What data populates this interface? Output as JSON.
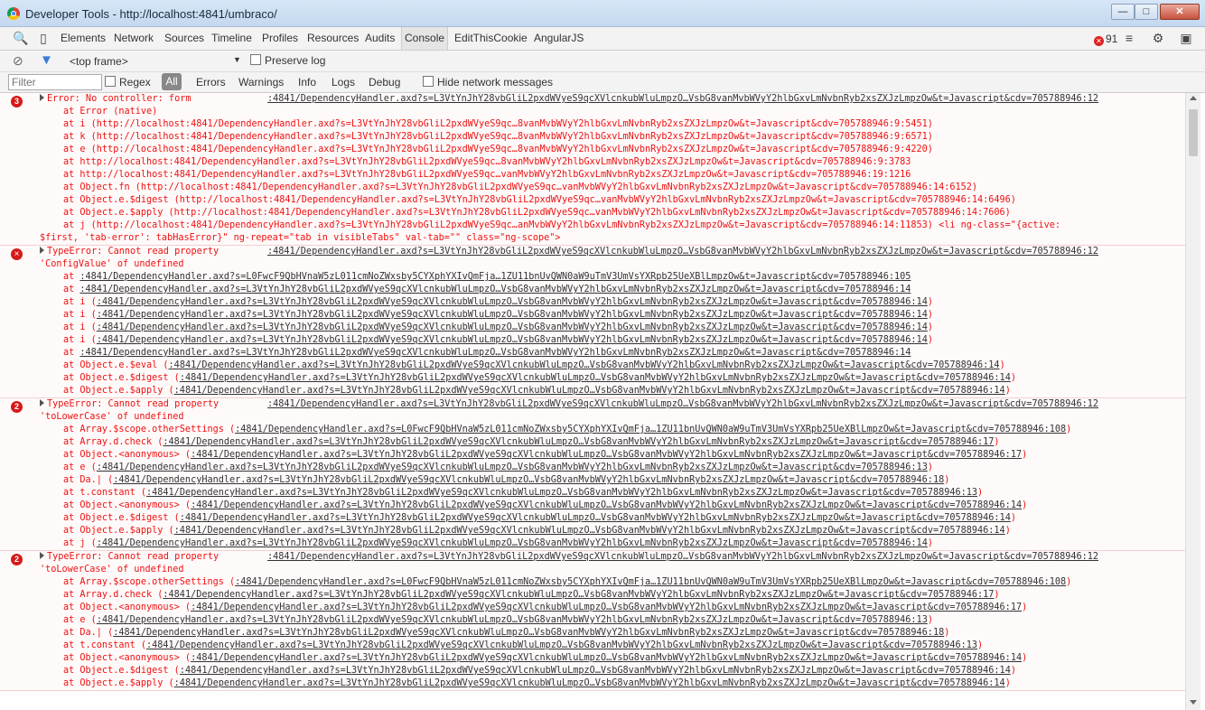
{
  "window": {
    "title": "Developer Tools - http://localhost:4841/umbraco/"
  },
  "tabs": [
    {
      "label": "Elements"
    },
    {
      "label": "Network"
    },
    {
      "label": "Sources"
    },
    {
      "label": "Timeline"
    },
    {
      "label": "Profiles"
    },
    {
      "label": "Resources"
    },
    {
      "label": "Audits"
    },
    {
      "label": "Console"
    },
    {
      "label": "EditThisCookie"
    },
    {
      "label": "AngularJS"
    }
  ],
  "error_count": "91",
  "console_toolbar": {
    "frame": "<top frame>",
    "preserve_log": "Preserve log"
  },
  "filter_bar": {
    "placeholder": "Filter",
    "regex": "Regex",
    "all": "All",
    "levels": [
      "Errors",
      "Warnings",
      "Info",
      "Logs",
      "Debug"
    ],
    "hide_network": "Hide network messages"
  },
  "messages": [
    {
      "badge": "3",
      "head": "Error: No controller: form",
      "source": ":4841/DependencyHandler.axd?s=L3VtYnJhY28vbGliL2pxdWVyeS9qcXVlcnkubWluLmpzO…VsbG8vanMvbWVyY2hlbGxvLmNvbnRyb2xsZXJzLmpzOw&t=Javascript&cdv=705788946:12",
      "lines": [
        {
          "indent": "l1",
          "text": "at Error (native)"
        },
        {
          "indent": "l1",
          "text": "at i (http://localhost:4841/DependencyHandler.axd?s=L3VtYnJhY28vbGliL2pxdWVyeS9qc…8vanMvbWVyY2hlbGxvLmNvbnRyb2xsZXJzLmpzOw&t=Javascript&cdv=705788946:9:5451)"
        },
        {
          "indent": "l1",
          "text": "at k (http://localhost:4841/DependencyHandler.axd?s=L3VtYnJhY28vbGliL2pxdWVyeS9qc…8vanMvbWVyY2hlbGxvLmNvbnRyb2xsZXJzLmpzOw&t=Javascript&cdv=705788946:9:6571)"
        },
        {
          "indent": "l1",
          "text": "at e (http://localhost:4841/DependencyHandler.axd?s=L3VtYnJhY28vbGliL2pxdWVyeS9qc…8vanMvbWVyY2hlbGxvLmNvbnRyb2xsZXJzLmpzOw&t=Javascript&cdv=705788946:9:4220)"
        },
        {
          "indent": "l1",
          "text": "at http://localhost:4841/DependencyHandler.axd?s=L3VtYnJhY28vbGliL2pxdWVyeS9qc…8vanMvbWVyY2hlbGxvLmNvbnRyb2xsZXJzLmpzOw&t=Javascript&cdv=705788946:9:3783"
        },
        {
          "indent": "l1",
          "text": "at http://localhost:4841/DependencyHandler.axd?s=L3VtYnJhY28vbGliL2pxdWVyeS9qc…vanMvbWVyY2hlbGxvLmNvbnRyb2xsZXJzLmpzOw&t=Javascript&cdv=705788946:19:1216"
        },
        {
          "indent": "l1",
          "text": "at Object.fn (http://localhost:4841/DependencyHandler.axd?s=L3VtYnJhY28vbGliL2pxdWVyeS9qc…vanMvbWVyY2hlbGxvLmNvbnRyb2xsZXJzLmpzOw&t=Javascript&cdv=705788946:14:6152)"
        },
        {
          "indent": "l1",
          "text": "at Object.e.$digest (http://localhost:4841/DependencyHandler.axd?s=L3VtYnJhY28vbGliL2pxdWVyeS9qc…vanMvbWVyY2hlbGxvLmNvbnRyb2xsZXJzLmpzOw&t=Javascript&cdv=705788946:14:6496)"
        },
        {
          "indent": "l1",
          "text": "at Object.e.$apply (http://localhost:4841/DependencyHandler.axd?s=L3VtYnJhY28vbGliL2pxdWVyeS9qc…vanMvbWVyY2hlbGxvLmNvbnRyb2xsZXJzLmpzOw&t=Javascript&cdv=705788946:14:7606)"
        },
        {
          "indent": "l1",
          "text": "at j (http://localhost:4841/DependencyHandler.axd?s=L3VtYnJhY28vbGliL2pxdWVyeS9qc…anMvbWVyY2hlbGxvLmNvbnRyb2xsZXJzLmpzOw&t=Javascript&cdv=705788946:14:11853) <li ng-class=\"{active:"
        },
        {
          "indent": "l2",
          "text": "$first, 'tab-error': tabHasError}\" ng-repeat=\"tab in visibleTabs\" val-tab=\"\" class=\"ng-scope\">"
        }
      ]
    },
    {
      "badge": "×",
      "head": "TypeError: Cannot read property",
      "source": ":4841/DependencyHandler.axd?s=L3VtYnJhY28vbGliL2pxdWVyeS9qcXVlcnkubWluLmpzO…VsbG8vanMvbWVyY2hlbGxvLmNvbnRyb2xsZXJzLmpzOw&t=Javascript&cdv=705788946:12",
      "lines": [
        {
          "indent": "l2",
          "text": "'ConfigValue' of undefined"
        },
        {
          "indent": "l1",
          "pre": "at ",
          "src": ":4841/DependencyHandler.axd?s=L0FwcF9QbHVnaW5zL011cmNoZWxsby5CYXphYXIvQmFja…1ZU11bnUvQWN0aW9uTmV3UmVsYXRpb25UeXBlLmpzOw&t=Javascript&cdv=705788946:105"
        },
        {
          "indent": "l1",
          "pre": "at ",
          "src": ":4841/DependencyHandler.axd?s=L3VtYnJhY28vbGliL2pxdWVyeS9qcXVlcnkubWluLmpzO…VsbG8vanMvbWVyY2hlbGxvLmNvbnRyb2xsZXJzLmpzOw&t=Javascript&cdv=705788946:14"
        },
        {
          "indent": "l1",
          "pre": "at i (",
          "src": ":4841/DependencyHandler.axd?s=L3VtYnJhY28vbGliL2pxdWVyeS9qcXVlcnkubWluLmpzO…VsbG8vanMvbWVyY2hlbGxvLmNvbnRyb2xsZXJzLmpzOw&t=Javascript&cdv=705788946:14",
          "post": ")"
        },
        {
          "indent": "l1",
          "pre": "at i (",
          "src": ":4841/DependencyHandler.axd?s=L3VtYnJhY28vbGliL2pxdWVyeS9qcXVlcnkubWluLmpzO…VsbG8vanMvbWVyY2hlbGxvLmNvbnRyb2xsZXJzLmpzOw&t=Javascript&cdv=705788946:14",
          "post": ")"
        },
        {
          "indent": "l1",
          "pre": "at i (",
          "src": ":4841/DependencyHandler.axd?s=L3VtYnJhY28vbGliL2pxdWVyeS9qcXVlcnkubWluLmpzO…VsbG8vanMvbWVyY2hlbGxvLmNvbnRyb2xsZXJzLmpzOw&t=Javascript&cdv=705788946:14",
          "post": ")"
        },
        {
          "indent": "l1",
          "pre": "at i (",
          "src": ":4841/DependencyHandler.axd?s=L3VtYnJhY28vbGliL2pxdWVyeS9qcXVlcnkubWluLmpzO…VsbG8vanMvbWVyY2hlbGxvLmNvbnRyb2xsZXJzLmpzOw&t=Javascript&cdv=705788946:14",
          "post": ")"
        },
        {
          "indent": "l1",
          "pre": "at ",
          "src": ":4841/DependencyHandler.axd?s=L3VtYnJhY28vbGliL2pxdWVyeS9qcXVlcnkubWluLmpzO…VsbG8vanMvbWVyY2hlbGxvLmNvbnRyb2xsZXJzLmpzOw&t=Javascript&cdv=705788946:14"
        },
        {
          "indent": "l1",
          "pre": "at Object.e.$eval (",
          "src": ":4841/DependencyHandler.axd?s=L3VtYnJhY28vbGliL2pxdWVyeS9qcXVlcnkubWluLmpzO…VsbG8vanMvbWVyY2hlbGxvLmNvbnRyb2xsZXJzLmpzOw&t=Javascript&cdv=705788946:14",
          "post": ")"
        },
        {
          "indent": "l1",
          "pre": "at Object.e.$digest (",
          "src": ":4841/DependencyHandler.axd?s=L3VtYnJhY28vbGliL2pxdWVyeS9qcXVlcnkubWluLmpzO…VsbG8vanMvbWVyY2hlbGxvLmNvbnRyb2xsZXJzLmpzOw&t=Javascript&cdv=705788946:14",
          "post": ")"
        },
        {
          "indent": "l1",
          "pre": "at Object.e.$apply (",
          "src": ":4841/DependencyHandler.axd?s=L3VtYnJhY28vbGliL2pxdWVyeS9qcXVlcnkubWluLmpzO…VsbG8vanMvbWVyY2hlbGxvLmNvbnRyb2xsZXJzLmpzOw&t=Javascript&cdv=705788946:14",
          "post": ")"
        }
      ]
    },
    {
      "badge": "2",
      "head": "TypeError: Cannot read property",
      "source": ":4841/DependencyHandler.axd?s=L3VtYnJhY28vbGliL2pxdWVyeS9qcXVlcnkubWluLmpzO…VsbG8vanMvbWVyY2hlbGxvLmNvbnRyb2xsZXJzLmpzOw&t=Javascript&cdv=705788946:12",
      "lines": [
        {
          "indent": "l2",
          "text": "'toLowerCase' of undefined"
        },
        {
          "indent": "l1",
          "pre": "at Array.$scope.otherSettings (",
          "src": ":4841/DependencyHandler.axd?s=L0FwcF9QbHVnaW5zL011cmNoZWxsby5CYXphYXIvQmFja…1ZU11bnUvQWN0aW9uTmV3UmVsYXRpb25UeXBlLmpzOw&t=Javascript&cdv=705788946:108",
          "post": ")"
        },
        {
          "indent": "l1",
          "pre": "at Array.d.check (",
          "src": ":4841/DependencyHandler.axd?s=L3VtYnJhY28vbGliL2pxdWVyeS9qcXVlcnkubWluLmpzO…VsbG8vanMvbWVyY2hlbGxvLmNvbnRyb2xsZXJzLmpzOw&t=Javascript&cdv=705788946:17",
          "post": ")"
        },
        {
          "indent": "l1",
          "pre": "at Object.<anonymous> (",
          "src": ":4841/DependencyHandler.axd?s=L3VtYnJhY28vbGliL2pxdWVyeS9qcXVlcnkubWluLmpzO…VsbG8vanMvbWVyY2hlbGxvLmNvbnRyb2xsZXJzLmpzOw&t=Javascript&cdv=705788946:17",
          "post": ")"
        },
        {
          "indent": "l1",
          "pre": "at e (",
          "src": ":4841/DependencyHandler.axd?s=L3VtYnJhY28vbGliL2pxdWVyeS9qcXVlcnkubWluLmpzO…VsbG8vanMvbWVyY2hlbGxvLmNvbnRyb2xsZXJzLmpzOw&t=Javascript&cdv=705788946:13",
          "post": ")"
        },
        {
          "indent": "l1",
          "pre": "at Da.| (",
          "src": ":4841/DependencyHandler.axd?s=L3VtYnJhY28vbGliL2pxdWVyeS9qcXVlcnkubWluLmpzO…VsbG8vanMvbWVyY2hlbGxvLmNvbnRyb2xsZXJzLmpzOw&t=Javascript&cdv=705788946:18",
          "post": ")"
        },
        {
          "indent": "l1",
          "pre": "at t.constant (",
          "src": ":4841/DependencyHandler.axd?s=L3VtYnJhY28vbGliL2pxdWVyeS9qcXVlcnkubWluLmpzO…VsbG8vanMvbWVyY2hlbGxvLmNvbnRyb2xsZXJzLmpzOw&t=Javascript&cdv=705788946:13",
          "post": ")"
        },
        {
          "indent": "l1",
          "pre": "at Object.<anonymous> (",
          "src": ":4841/DependencyHandler.axd?s=L3VtYnJhY28vbGliL2pxdWVyeS9qcXVlcnkubWluLmpzO…VsbG8vanMvbWVyY2hlbGxvLmNvbnRyb2xsZXJzLmpzOw&t=Javascript&cdv=705788946:14",
          "post": ")"
        },
        {
          "indent": "l1",
          "pre": "at Object.e.$digest (",
          "src": ":4841/DependencyHandler.axd?s=L3VtYnJhY28vbGliL2pxdWVyeS9qcXVlcnkubWluLmpzO…VsbG8vanMvbWVyY2hlbGxvLmNvbnRyb2xsZXJzLmpzOw&t=Javascript&cdv=705788946:14",
          "post": ")"
        },
        {
          "indent": "l1",
          "pre": "at Object.e.$apply (",
          "src": ":4841/DependencyHandler.axd?s=L3VtYnJhY28vbGliL2pxdWVyeS9qcXVlcnkubWluLmpzO…VsbG8vanMvbWVyY2hlbGxvLmNvbnRyb2xsZXJzLmpzOw&t=Javascript&cdv=705788946:14",
          "post": ")"
        },
        {
          "indent": "l1",
          "pre": "at j (",
          "src": ":4841/DependencyHandler.axd?s=L3VtYnJhY28vbGliL2pxdWVyeS9qcXVlcnkubWluLmpzO…VsbG8vanMvbWVyY2hlbGxvLmNvbnRyb2xsZXJzLmpzOw&t=Javascript&cdv=705788946:14",
          "post": ")"
        }
      ]
    },
    {
      "badge": "2",
      "head": "TypeError: Cannot read property",
      "source": ":4841/DependencyHandler.axd?s=L3VtYnJhY28vbGliL2pxdWVyeS9qcXVlcnkubWluLmpzO…VsbG8vanMvbWVyY2hlbGxvLmNvbnRyb2xsZXJzLmpzOw&t=Javascript&cdv=705788946:12",
      "lines": [
        {
          "indent": "l2",
          "text": "'toLowerCase' of undefined"
        },
        {
          "indent": "l1",
          "pre": "at Array.$scope.otherSettings (",
          "src": ":4841/DependencyHandler.axd?s=L0FwcF9QbHVnaW5zL011cmNoZWxsby5CYXphYXIvQmFja…1ZU11bnUvQWN0aW9uTmV3UmVsYXRpb25UeXBlLmpzOw&t=Javascript&cdv=705788946:108",
          "post": ")"
        },
        {
          "indent": "l1",
          "pre": "at Array.d.check (",
          "src": ":4841/DependencyHandler.axd?s=L3VtYnJhY28vbGliL2pxdWVyeS9qcXVlcnkubWluLmpzO…VsbG8vanMvbWVyY2hlbGxvLmNvbnRyb2xsZXJzLmpzOw&t=Javascript&cdv=705788946:17",
          "post": ")"
        },
        {
          "indent": "l1",
          "pre": "at Object.<anonymous> (",
          "src": ":4841/DependencyHandler.axd?s=L3VtYnJhY28vbGliL2pxdWVyeS9qcXVlcnkubWluLmpzO…VsbG8vanMvbWVyY2hlbGxvLmNvbnRyb2xsZXJzLmpzOw&t=Javascript&cdv=705788946:17",
          "post": ")"
        },
        {
          "indent": "l1",
          "pre": "at e (",
          "src": ":4841/DependencyHandler.axd?s=L3VtYnJhY28vbGliL2pxdWVyeS9qcXVlcnkubWluLmpzO…VsbG8vanMvbWVyY2hlbGxvLmNvbnRyb2xsZXJzLmpzOw&t=Javascript&cdv=705788946:13",
          "post": ")"
        },
        {
          "indent": "l1",
          "pre": "at Da.| (",
          "src": ":4841/DependencyHandler.axd?s=L3VtYnJhY28vbGliL2pxdWVyeS9qcXVlcnkubWluLmpzO…VsbG8vanMvbWVyY2hlbGxvLmNvbnRyb2xsZXJzLmpzOw&t=Javascript&cdv=705788946:18",
          "post": ")"
        },
        {
          "indent": "l1",
          "pre": "at t.constant (",
          "src": ":4841/DependencyHandler.axd?s=L3VtYnJhY28vbGliL2pxdWVyeS9qcXVlcnkubWluLmpzO…VsbG8vanMvbWVyY2hlbGxvLmNvbnRyb2xsZXJzLmpzOw&t=Javascript&cdv=705788946:13",
          "post": ")"
        },
        {
          "indent": "l1",
          "pre": "at Object.<anonymous> (",
          "src": ":4841/DependencyHandler.axd?s=L3VtYnJhY28vbGliL2pxdWVyeS9qcXVlcnkubWluLmpzO…VsbG8vanMvbWVyY2hlbGxvLmNvbnRyb2xsZXJzLmpzOw&t=Javascript&cdv=705788946:14",
          "post": ")"
        },
        {
          "indent": "l1",
          "pre": "at Object.e.$digest (",
          "src": ":4841/DependencyHandler.axd?s=L3VtYnJhY28vbGliL2pxdWVyeS9qcXVlcnkubWluLmpzO…VsbG8vanMvbWVyY2hlbGxvLmNvbnRyb2xsZXJzLmpzOw&t=Javascript&cdv=705788946:14",
          "post": ")"
        },
        {
          "indent": "l1",
          "pre": "at Object.e.$apply (",
          "src": ":4841/DependencyHandler.axd?s=L3VtYnJhY28vbGliL2pxdWVyeS9qcXVlcnkubWluLmpzO…VsbG8vanMvbWVyY2hlbGxvLmNvbnRyb2xsZXJzLmpzOw&t=Javascript&cdv=705788946:14",
          "post": ")"
        }
      ]
    }
  ]
}
